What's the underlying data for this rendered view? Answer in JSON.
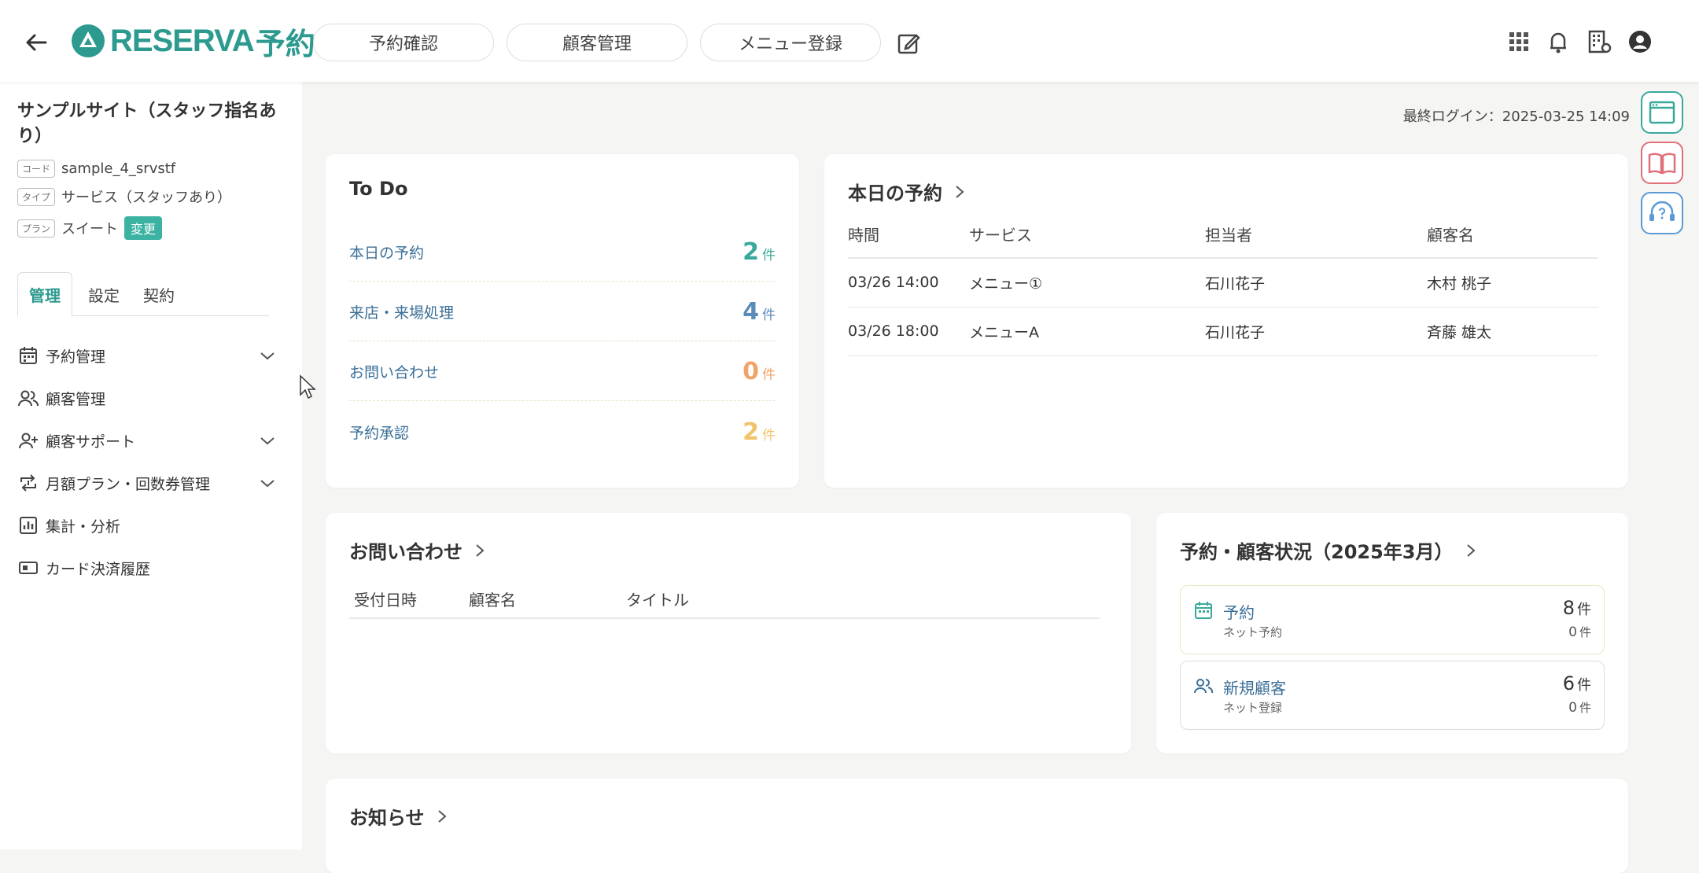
{
  "header": {
    "logo_text": "RESERVA",
    "logo_kanji": "予約",
    "nav": [
      "予約確認",
      "顧客管理",
      "メニュー登録"
    ]
  },
  "sidebar": {
    "site_name": "サンプルサイト（スタッフ指名あり）",
    "code_label": "コード",
    "code_value": "sample_4_srvstf",
    "type_label": "タイプ",
    "type_value": "サービス（スタッフあり）",
    "plan_label": "プラン",
    "plan_value": "スイート",
    "plan_change": "変更",
    "tabs": [
      "管理",
      "設定",
      "契約"
    ],
    "items": [
      {
        "label": "予約管理",
        "icon": "calendar-icon",
        "expandable": true
      },
      {
        "label": "顧客管理",
        "icon": "users-icon",
        "expandable": false
      },
      {
        "label": "顧客サポート",
        "icon": "user-add-icon",
        "expandable": true
      },
      {
        "label": "月額プラン・回数券管理",
        "icon": "repeat-icon",
        "expandable": true
      },
      {
        "label": "集計・分析",
        "icon": "bar-chart-icon",
        "expandable": false
      },
      {
        "label": "カード決済履歴",
        "icon": "card-icon",
        "expandable": false
      }
    ]
  },
  "main": {
    "last_login": "最終ログイン：2025-03-25 14:09",
    "todo": {
      "title": "To Do",
      "unit": "件",
      "rows": [
        {
          "label": "本日の予約",
          "count": "2",
          "color": "#3aa99b"
        },
        {
          "label": "来店・来場処理",
          "count": "4",
          "color": "#5b8bb8"
        },
        {
          "label": "お問い合わせ",
          "count": "0",
          "color": "#f0a46a"
        },
        {
          "label": "予約承認",
          "count": "2",
          "color": "#f2c46a"
        }
      ]
    },
    "today": {
      "title": "本日の予約",
      "headers": [
        "時間",
        "サービス",
        "担当者",
        "顧客名"
      ],
      "rows": [
        [
          "03/26 14:00",
          "メニュー①",
          "石川花子",
          "木村 桃子"
        ],
        [
          "03/26 18:00",
          "メニューA",
          "石川花子",
          "斉藤 雄太"
        ]
      ]
    },
    "inquiry": {
      "title": "お問い合わせ",
      "headers": [
        "受付日時",
        "顧客名",
        "タイトル"
      ]
    },
    "status": {
      "title": "予約・顧客状況（2025年3月）",
      "items": [
        {
          "label": "予約",
          "sub": "ネット予約",
          "value": "8",
          "sub_value": "0",
          "unit": "件",
          "icon": "calendar-icon"
        },
        {
          "label": "新規顧客",
          "sub": "ネット登録",
          "value": "6",
          "sub_value": "0",
          "unit": "件",
          "icon": "users-icon"
        }
      ]
    },
    "notice": {
      "title": "お知らせ"
    }
  },
  "colors": {
    "accent": "#2d9a8f",
    "link": "#3a6f98"
  }
}
